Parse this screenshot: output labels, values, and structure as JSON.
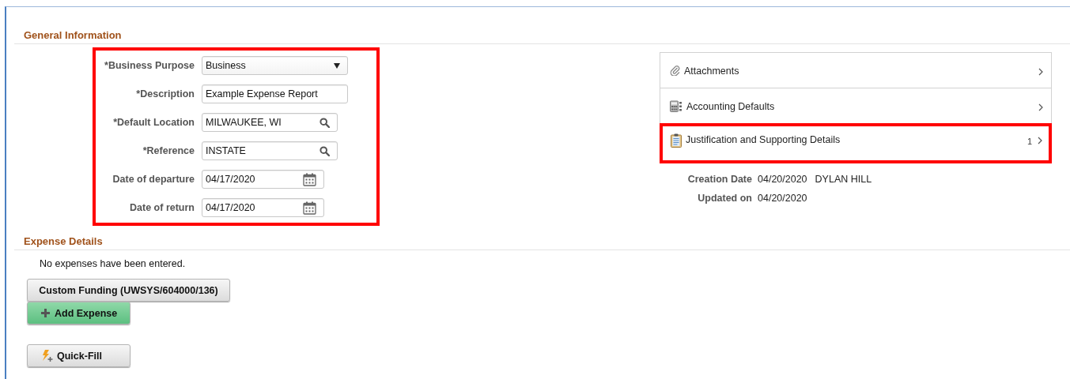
{
  "general_information": {
    "title": "General Information",
    "form": {
      "highlighted": true,
      "fields": [
        {
          "kind": "select",
          "label": "*Business Purpose",
          "value": "Business"
        },
        {
          "kind": "text",
          "label": "*Description",
          "value": "Example Expense Report"
        },
        {
          "kind": "lookup",
          "label": "*Default Location",
          "value": "MILWAUKEE, WI"
        },
        {
          "kind": "lookup",
          "label": "*Reference",
          "value": "INSTATE"
        },
        {
          "kind": "date",
          "label": "Date of departure",
          "value": "04/17/2020"
        },
        {
          "kind": "date",
          "label": "Date of return",
          "value": "04/17/2020"
        }
      ]
    },
    "panel_items": [
      {
        "kind": "attachments",
        "label": "Attachments",
        "highlighted": false
      },
      {
        "kind": "accounting",
        "label": "Accounting Defaults",
        "highlighted": false
      },
      {
        "kind": "justification",
        "label": "Justification and Supporting Details",
        "count": "1",
        "highlighted": true
      }
    ],
    "info": [
      {
        "label": "Creation Date",
        "values": [
          "04/20/2020",
          "DYLAN HILL"
        ]
      },
      {
        "label": "Updated on",
        "values": [
          "04/20/2020"
        ]
      }
    ]
  },
  "expense_details": {
    "title": "Expense Details",
    "message": "No expenses have been entered.",
    "buttons": [
      {
        "kind": "funding",
        "label": "Custom Funding (UWSYS/604000/136)"
      },
      {
        "kind": "add",
        "label": "Add Expense"
      },
      {
        "kind": "quickfill",
        "label": "Quick-Fill"
      }
    ]
  }
}
